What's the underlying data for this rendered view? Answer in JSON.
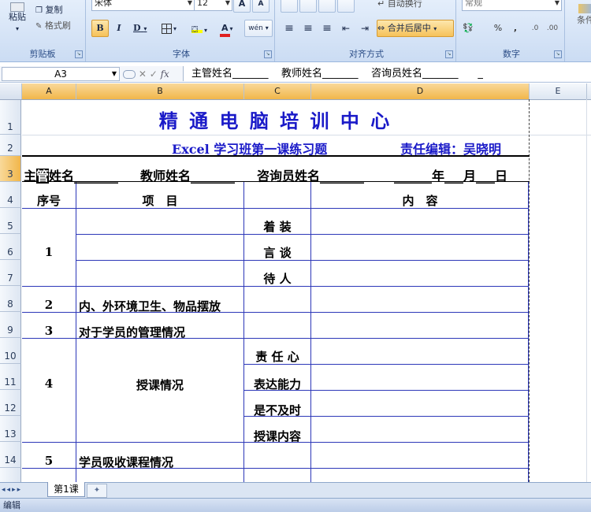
{
  "ribbon": {
    "clipboard": {
      "label": "剪贴板",
      "paste": "粘贴",
      "copy": "复制",
      "format_painter": "格式刷"
    },
    "font": {
      "label": "字体",
      "font_name": "宋体",
      "font_size": "12",
      "bold": "B",
      "italic": "I",
      "underline": "D",
      "font_color_glyph": "A",
      "grow_glyph": "A",
      "shrink_glyph": "A",
      "phonetic": "wén"
    },
    "alignment": {
      "label": "对齐方式",
      "wrap": "自动换行",
      "merge_center": "合并后居中"
    },
    "number": {
      "label": "数字",
      "format": "常规",
      "percent": "%",
      "comma": ","
    },
    "styles": {
      "cond_format": "条件"
    }
  },
  "formula_bar": {
    "name_box": "A3",
    "fx": "fx",
    "content": "主管姓名_______    教师姓名_______    咨询员姓名_______      _"
  },
  "columns": [
    "A",
    "B",
    "C",
    "D",
    "E"
  ],
  "rows": [
    "1",
    "2",
    "3",
    "4",
    "5",
    "6",
    "7",
    "8",
    "9",
    "10",
    "11",
    "12",
    "13",
    "14"
  ],
  "sheet": {
    "title": "精 通 电 脑 培 训 中 心",
    "subtitle": "Excel 学习班第一课练习题",
    "editor": "责任编辑：吴晓明",
    "row3": {
      "manager_pre": "主",
      "manager_sel": "管",
      "manager_post": "姓名_______",
      "teacher": "教师姓名_______",
      "counselor": "咨询员姓名_______",
      "date": "______年___月___日"
    },
    "headers": {
      "seq": "序号",
      "item": "项　目",
      "content": "内　容"
    },
    "seq": [
      "1",
      "2",
      "3",
      "4",
      "5"
    ],
    "items": [
      "内、外环境卫生、物品摆放",
      "对于学员的管理情况",
      "授课情况",
      "学员吸收课程情况"
    ],
    "sub_items": [
      "着 装",
      "言 谈",
      "待 人",
      "责 任 心",
      "表达能力",
      "是不及时",
      "授课内容"
    ]
  },
  "tabs": {
    "sheet1": "第1课"
  },
  "status": {
    "mode": "编辑"
  },
  "colors": {
    "title": "#1a1ac8",
    "border": "#2c37b8",
    "active_header": "#f1b64a"
  }
}
